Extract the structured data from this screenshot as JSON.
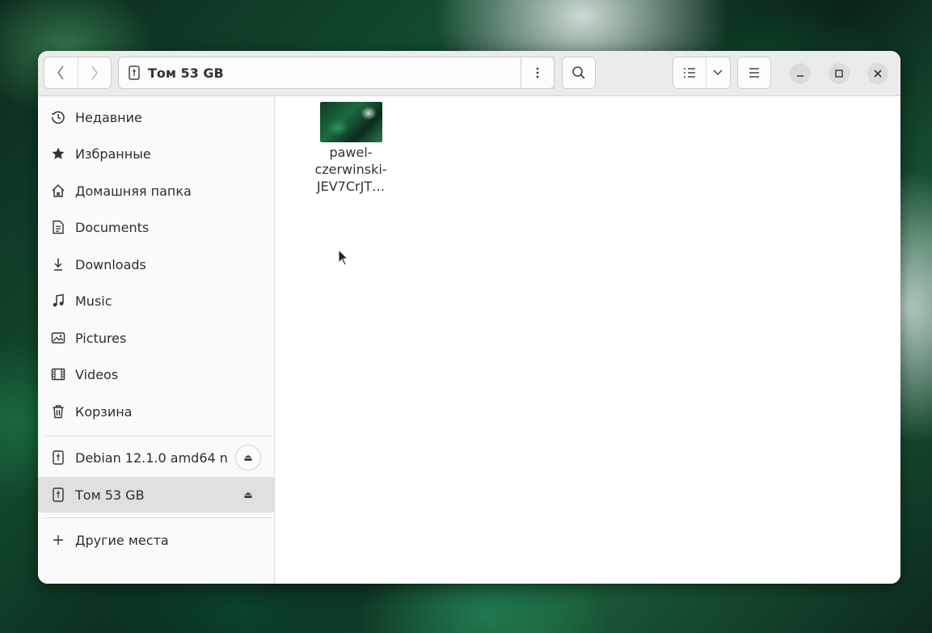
{
  "toolbar": {
    "back_icon": "chevron-left-icon",
    "forward_icon": "chevron-right-icon",
    "location_icon": "usb-drive-icon",
    "location": "Том 53 GB",
    "path_menu_icon": "vertical-dots-icon",
    "search_icon": "search-icon",
    "list_view_icon": "list-view-icon",
    "view_options_icon": "chevron-down-icon",
    "main_menu_icon": "hamburger-menu-icon",
    "minimize_icon": "minimize-icon",
    "maximize_icon": "maximize-icon",
    "close_icon": "close-icon"
  },
  "sidebar": {
    "places": [
      {
        "label": "Недавние",
        "icon": "clock-icon"
      },
      {
        "label": "Избранные",
        "icon": "star-icon"
      },
      {
        "label": "Домашняя папка",
        "icon": "home-icon"
      },
      {
        "label": "Documents",
        "icon": "document-icon"
      },
      {
        "label": "Downloads",
        "icon": "download-icon"
      },
      {
        "label": "Music",
        "icon": "music-icon"
      },
      {
        "label": "Pictures",
        "icon": "picture-icon"
      },
      {
        "label": "Videos",
        "icon": "video-icon"
      },
      {
        "label": "Корзина",
        "icon": "trash-icon"
      }
    ],
    "devices": [
      {
        "label": "Debian 12.1.0 amd64 n",
        "icon": "usb-drive-icon",
        "eject_icon": "eject-icon"
      },
      {
        "label": "Том 53 GB",
        "icon": "usb-drive-icon",
        "eject_icon": "eject-icon",
        "active": true
      }
    ],
    "other": {
      "label": "Другие места",
      "icon": "plus-icon"
    }
  },
  "files": [
    {
      "name_lines": [
        "pawel-",
        "czerwinski-",
        "JEV7CrJT…"
      ],
      "type": "image"
    }
  ]
}
